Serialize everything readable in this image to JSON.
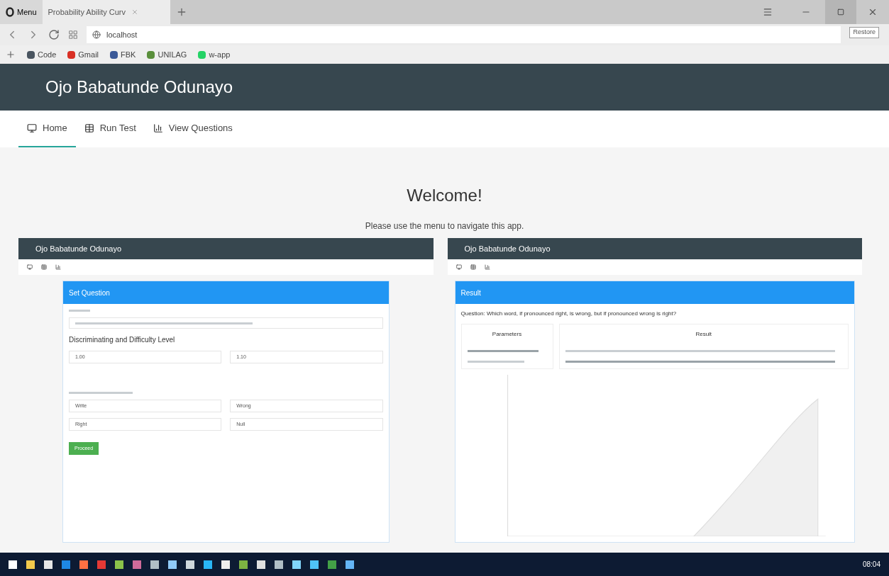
{
  "browser": {
    "menu_label": "Menu",
    "tabs": [
      {
        "title": "Probability Ability Curv",
        "selected": true
      }
    ],
    "address": "localhost",
    "tooltip": "Restore",
    "bookmarks": [
      {
        "label": "Code",
        "color": "#4a5560"
      },
      {
        "label": "Gmail",
        "color": "#d93025"
      },
      {
        "label": "FBK",
        "color": "#3b5998"
      },
      {
        "label": "UNILAG",
        "color": "#5a8f3c"
      },
      {
        "label": "w-app",
        "color": "#25d366"
      }
    ]
  },
  "app": {
    "title": "Ojo Babatunde Odunayo",
    "nav": [
      {
        "label": "Home",
        "selected": true
      },
      {
        "label": "Run Test",
        "selected": false
      },
      {
        "label": "View Questions",
        "selected": false
      }
    ],
    "heading": "Welcome!",
    "subtitle": "Please use the menu to navigate this app."
  },
  "previews": [
    {
      "kind": "form",
      "title": "Ojo Babatunde Odunayo",
      "card_title": "Set Question",
      "section": "Discriminating and Difficulty Level",
      "values": [
        "1.00",
        "1.10"
      ],
      "options": [
        "Write",
        "Wrong",
        "Right",
        "Null"
      ],
      "button": "Proceed"
    },
    {
      "kind": "result",
      "title": "Ojo Babatunde Odunayo",
      "card_title": "Result",
      "question": "Question: Which word, if pronounced right, is wrong, but if pronounced wrong is right?",
      "params_heading": "Parameters",
      "result_heading": "Result"
    }
  ],
  "taskbar": {
    "apps": [
      {
        "color": "#ffffff"
      },
      {
        "color": "#f2c94c"
      },
      {
        "color": "#e6e6e6"
      },
      {
        "color": "#1e88e5"
      },
      {
        "color": "#ff7043"
      },
      {
        "color": "#e53935"
      },
      {
        "color": "#8bc34a"
      },
      {
        "color": "#d06b9a"
      },
      {
        "color": "#b0bec5"
      },
      {
        "color": "#90caf9"
      },
      {
        "color": "#cfd8dc"
      },
      {
        "color": "#29b6f6"
      },
      {
        "color": "#eeeeee"
      },
      {
        "color": "#7cb342"
      },
      {
        "color": "#e0e0e0"
      },
      {
        "color": "#b0bec5"
      },
      {
        "color": "#81d4fa"
      },
      {
        "color": "#4fc3f7"
      },
      {
        "color": "#43a047"
      },
      {
        "color": "#64b5f6"
      }
    ],
    "time": "08:04"
  }
}
